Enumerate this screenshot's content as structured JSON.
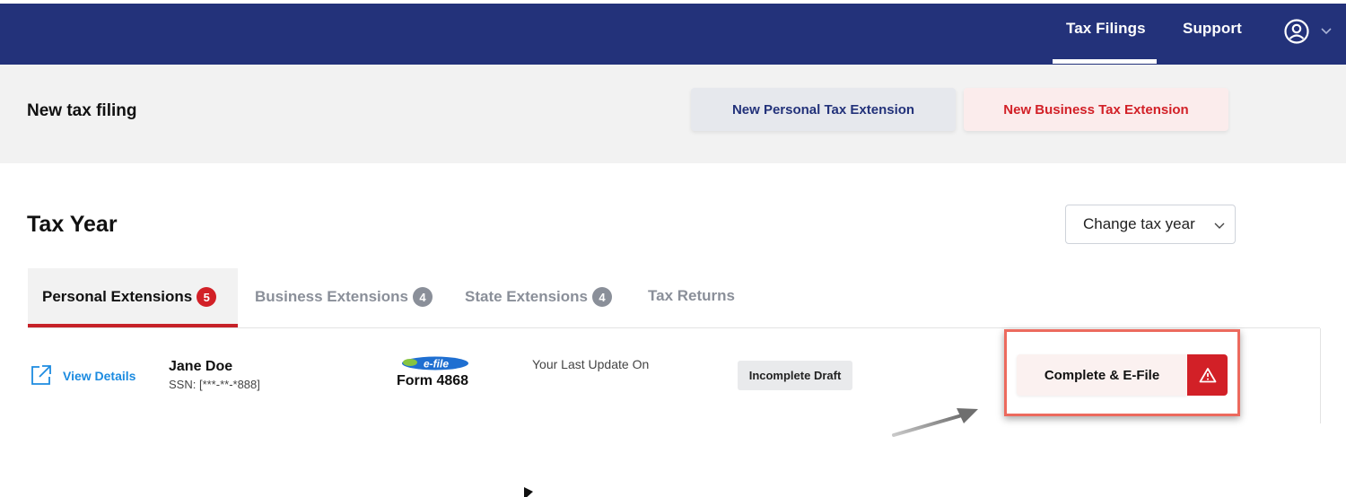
{
  "nav": {
    "tax_filings": "Tax Filings",
    "support": "Support",
    "user_icon": "user-circle-icon",
    "chevron_icon": "chevron-down-icon",
    "bar_color": "#23327a"
  },
  "new_filing": {
    "title": "New tax filing",
    "personal_button": "New Personal Tax Extension",
    "business_button": "New Business Tax Extension"
  },
  "tax_year": {
    "title": "Tax Year",
    "select_value": "Change tax year"
  },
  "tabs": [
    {
      "label": "Personal Extensions",
      "count": "5",
      "active": true
    },
    {
      "label": "Business Extensions",
      "count": "4",
      "active": false
    },
    {
      "label": "State Extensions",
      "count": "4",
      "active": false
    },
    {
      "label": "Tax Returns",
      "count": "",
      "active": false
    }
  ],
  "filing": {
    "view_details": "View Details",
    "name": "Jane Doe",
    "ssn": "SSN: [***-**-*888]",
    "efile_logo_text": "e-file",
    "form": "Form 4868",
    "last_update_label": "Your Last Update On",
    "status": "Incomplete Draft",
    "action_button": "Complete & E-File",
    "warning_icon": "warning-triangle-icon"
  },
  "colors": {
    "brand_navy": "#23327a",
    "brand_red": "#d22027",
    "link_blue": "#1c8be0",
    "highlight": "#ec6a5e"
  }
}
